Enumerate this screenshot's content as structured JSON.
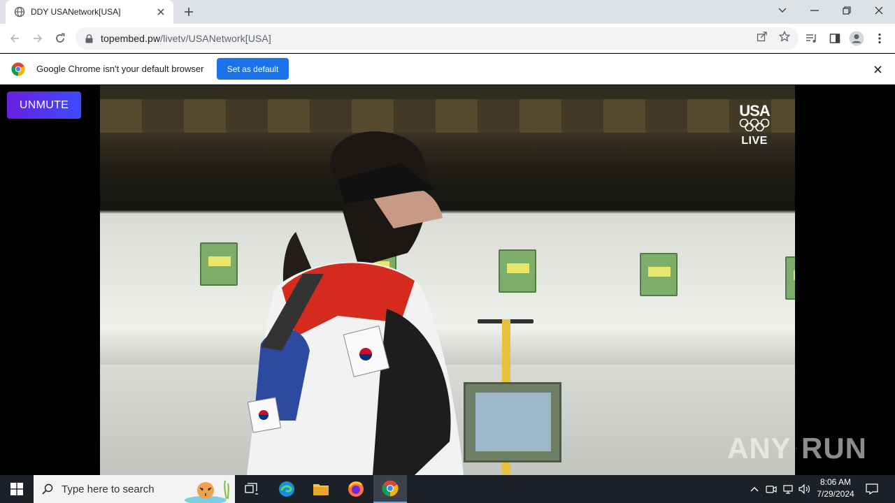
{
  "browser": {
    "tab": {
      "title": "DDY USANetwork[USA]"
    },
    "address": {
      "host": "topembed.pw",
      "path": "/livetv/USANetwork[USA]"
    }
  },
  "infobar": {
    "message": "Google Chrome isn't your default browser",
    "button_label": "Set as default"
  },
  "page": {
    "unmute_label": "UNMUTE",
    "overlay": {
      "network": "USA",
      "status": "LIVE"
    }
  },
  "watermark": {
    "left": "ANY",
    "right": "RUN"
  },
  "taskbar": {
    "search_placeholder": "Type here to search",
    "clock": {
      "time": "8:06 AM",
      "date": "7/29/2024"
    }
  },
  "colors": {
    "accent_blue": "#1a73e8",
    "unmute_start": "#6a1fe0",
    "unmute_end": "#3d4bff",
    "taskbar": "#1c2128"
  }
}
